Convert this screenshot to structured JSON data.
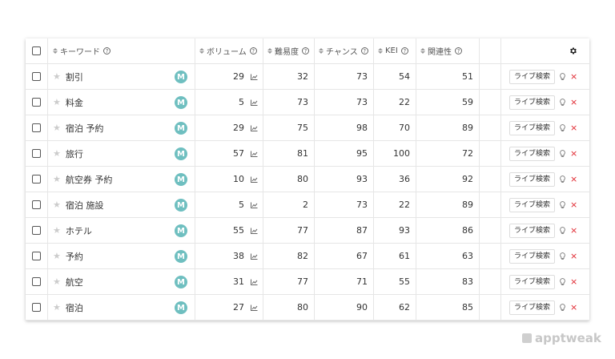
{
  "headers": {
    "keyword": "キーワード",
    "volume": "ボリューム",
    "difficulty": "難易度",
    "chance": "チャンス",
    "kei": "KEI",
    "relevance": "関連性"
  },
  "help_glyph": "?",
  "badge_letter": "M",
  "live_search_label": "ライブ検索",
  "delete_glyph": "×",
  "rows": [
    {
      "keyword": "割引",
      "volume": "29",
      "difficulty": "32",
      "chance": "73",
      "kei": "54",
      "relevance": "51"
    },
    {
      "keyword": "料金",
      "volume": "5",
      "difficulty": "73",
      "chance": "73",
      "kei": "22",
      "relevance": "59"
    },
    {
      "keyword": "宿泊 予約",
      "volume": "29",
      "difficulty": "75",
      "chance": "98",
      "kei": "70",
      "relevance": "89"
    },
    {
      "keyword": "旅行",
      "volume": "57",
      "difficulty": "81",
      "chance": "95",
      "kei": "100",
      "relevance": "72"
    },
    {
      "keyword": "航空券 予約",
      "volume": "10",
      "difficulty": "80",
      "chance": "93",
      "kei": "36",
      "relevance": "92"
    },
    {
      "keyword": "宿泊 施設",
      "volume": "5",
      "difficulty": "2",
      "chance": "73",
      "kei": "22",
      "relevance": "89"
    },
    {
      "keyword": "ホテル",
      "volume": "55",
      "difficulty": "77",
      "chance": "87",
      "kei": "93",
      "relevance": "86"
    },
    {
      "keyword": "予約",
      "volume": "38",
      "difficulty": "82",
      "chance": "67",
      "kei": "61",
      "relevance": "63"
    },
    {
      "keyword": "航空",
      "volume": "31",
      "difficulty": "77",
      "chance": "71",
      "kei": "55",
      "relevance": "83"
    },
    {
      "keyword": "宿泊",
      "volume": "27",
      "difficulty": "80",
      "chance": "90",
      "kei": "62",
      "relevance": "85"
    }
  ],
  "watermark": "apptweak",
  "colors": {
    "badge": "#6fbfc0",
    "delete": "#e0262e"
  }
}
